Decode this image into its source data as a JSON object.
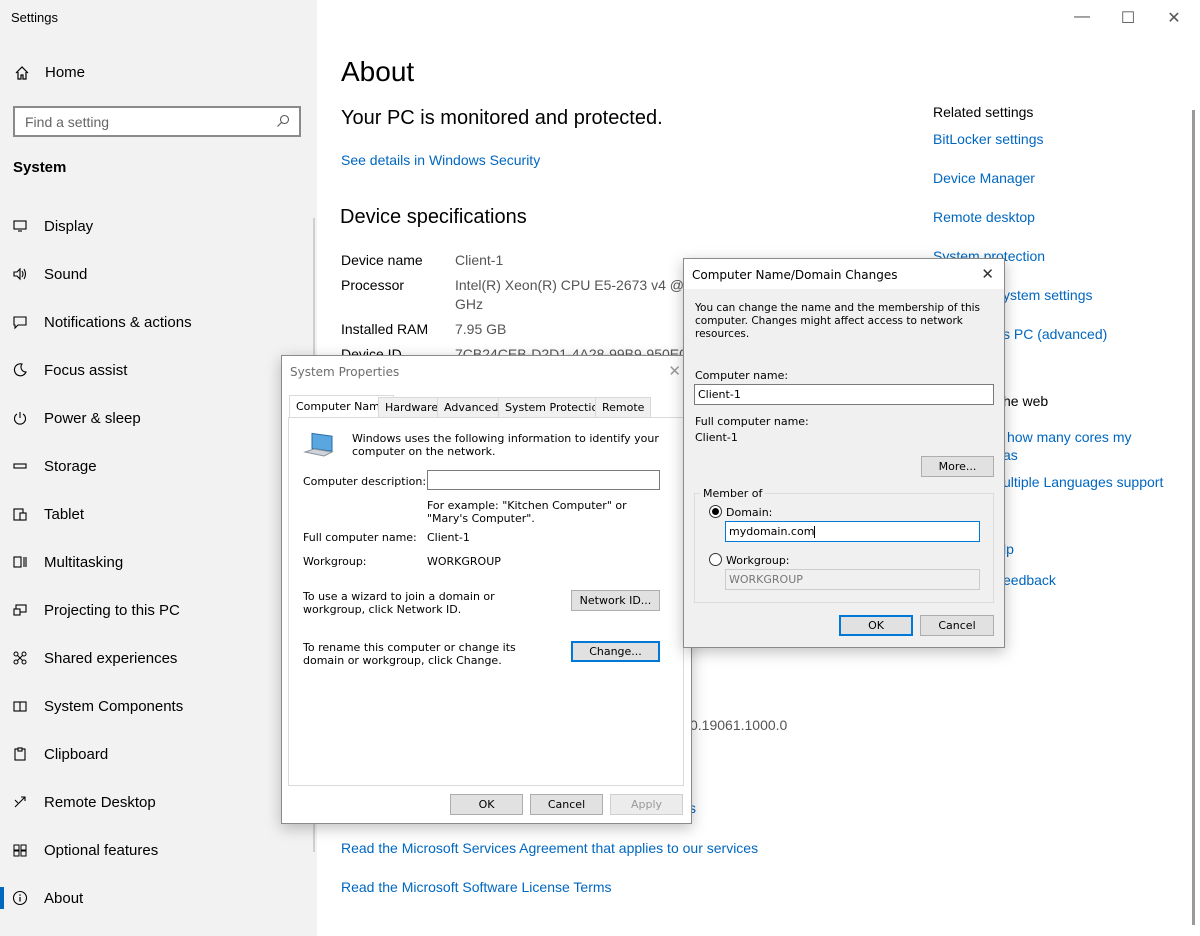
{
  "window": {
    "title": "Settings",
    "minimize": "—",
    "maximize": "☐",
    "close": "✕"
  },
  "sidebar": {
    "home": "Home",
    "search_placeholder": "Find a setting",
    "section": "System",
    "items": [
      {
        "label": "Display",
        "icon": "display-icon"
      },
      {
        "label": "Sound",
        "icon": "sound-icon"
      },
      {
        "label": "Notifications & actions",
        "icon": "notifications-icon"
      },
      {
        "label": "Focus assist",
        "icon": "focus-assist-icon"
      },
      {
        "label": "Power & sleep",
        "icon": "power-icon"
      },
      {
        "label": "Storage",
        "icon": "storage-icon"
      },
      {
        "label": "Tablet",
        "icon": "tablet-icon"
      },
      {
        "label": "Multitasking",
        "icon": "multitasking-icon"
      },
      {
        "label": "Projecting to this PC",
        "icon": "projecting-icon"
      },
      {
        "label": "Shared experiences",
        "icon": "shared-experiences-icon"
      },
      {
        "label": "System Components",
        "icon": "system-components-icon"
      },
      {
        "label": "Clipboard",
        "icon": "clipboard-icon"
      },
      {
        "label": "Remote Desktop",
        "icon": "remote-desktop-icon"
      },
      {
        "label": "Optional features",
        "icon": "optional-features-icon"
      },
      {
        "label": "About",
        "icon": "about-icon",
        "active": true
      }
    ]
  },
  "main": {
    "title": "About",
    "protected": "Your PC is monitored and protected.",
    "security_link": "See details in Windows Security",
    "device_specs": "Device specifications",
    "specs": [
      {
        "label": "Device name",
        "value": "Client-1"
      },
      {
        "label": "Processor",
        "value": "Intel(R) Xeon(R) CPU E5-2673 v4 @ 2"
      },
      {
        "label": "",
        "value": "GHz"
      },
      {
        "label": "Installed RAM",
        "value": "7.95 GB"
      },
      {
        "label": "Device ID",
        "value": "7CB24CEB-D2D1-4A28-99B9-950E05"
      }
    ],
    "os_build_fragment": "0.19061.1000.0",
    "fragment_s": "s",
    "services_link": "Read the Microsoft Services Agreement that applies to our services",
    "license_link": "Read the Microsoft Software License Terms"
  },
  "related": {
    "title": "Related settings",
    "links": [
      "BitLocker settings",
      "Device Manager",
      "Remote desktop",
      "System protection",
      "ystem settings",
      "s PC (advanced)"
    ],
    "web_title_fragment": "he web",
    "web_links": [
      "how many cores my",
      "as",
      "ultiple Languages support"
    ],
    "help_fragment": "lp",
    "feedback_fragment": "eedback"
  },
  "system_properties": {
    "title": "System Properties",
    "tabs": [
      "Computer Name",
      "Hardware",
      "Advanced",
      "System Protection",
      "Remote"
    ],
    "intro": "Windows uses the following information to identify your computer on the network.",
    "desc_label": "Computer description:",
    "desc_value": "",
    "example": "For example: \"Kitchen Computer\" or \"Mary's Computer\".",
    "full_name_label": "Full computer name:",
    "full_name_value": "Client-1",
    "workgroup_label": "Workgroup:",
    "workgroup_value": "WORKGROUP",
    "netid_text": "To use a wizard to join a domain or workgroup, click Network ID.",
    "netid_button": "Network ID...",
    "change_text": "To rename this computer or change its domain or workgroup, click Change.",
    "change_button": "Change...",
    "ok": "OK",
    "cancel": "Cancel",
    "apply": "Apply"
  },
  "domain_dialog": {
    "title": "Computer Name/Domain Changes",
    "intro": "You can change the name and the membership of this computer. Changes might affect access to network resources.",
    "computer_name_label": "Computer name:",
    "computer_name_value": "Client-1",
    "full_name_label": "Full computer name:",
    "full_name_value": "Client-1",
    "more_button": "More...",
    "member_of": "Member of",
    "domain_label": "Domain:",
    "domain_value": "mydomain.com",
    "workgroup_label": "Workgroup:",
    "workgroup_value": "WORKGROUP",
    "ok": "OK",
    "cancel": "Cancel"
  }
}
